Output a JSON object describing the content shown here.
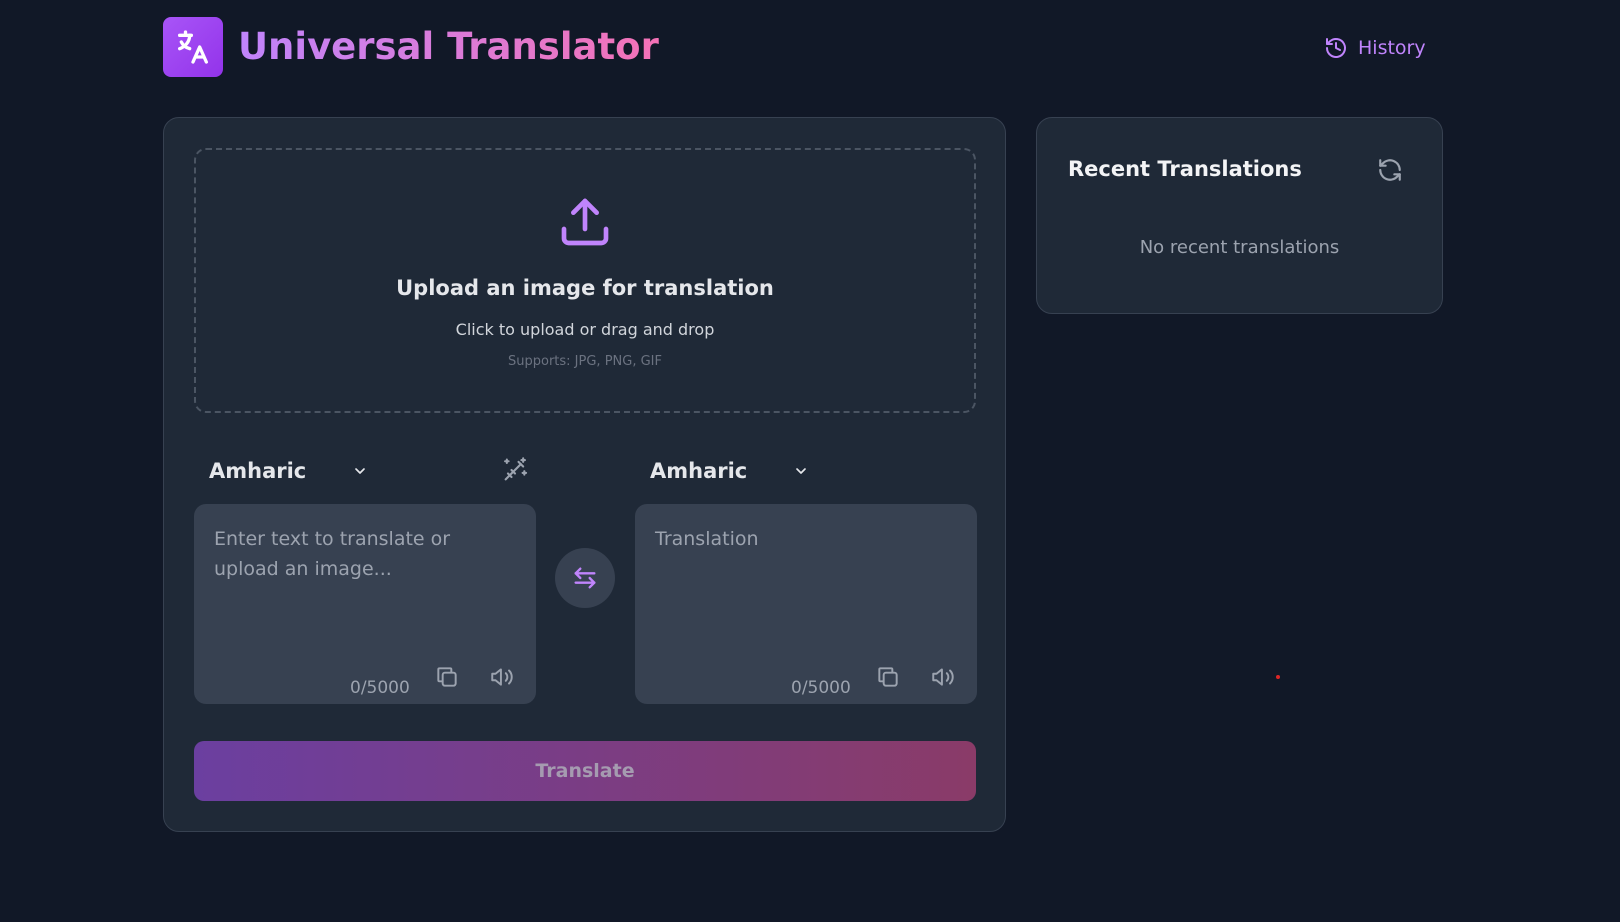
{
  "header": {
    "title": "Universal Translator",
    "logo_icon": "translate-icon",
    "history_label": "History"
  },
  "upload": {
    "icon": "upload-icon",
    "title": "Upload an image for translation",
    "subtitle": "Click to upload or drag and drop",
    "supports": "Supports: JPG, PNG, GIF"
  },
  "source": {
    "language": "Amharic",
    "placeholder": "Enter text to translate or upload an image...",
    "char_count": "0/5000"
  },
  "target": {
    "language": "Amharic",
    "placeholder": "Translation",
    "char_count": "0/5000"
  },
  "translate_label": "Translate",
  "recent": {
    "title": "Recent Translations",
    "empty": "No recent translations"
  },
  "colors": {
    "background": "#111827",
    "card": "#1f2937",
    "accent": "#c084fc",
    "accent_pink": "#f472b6"
  }
}
